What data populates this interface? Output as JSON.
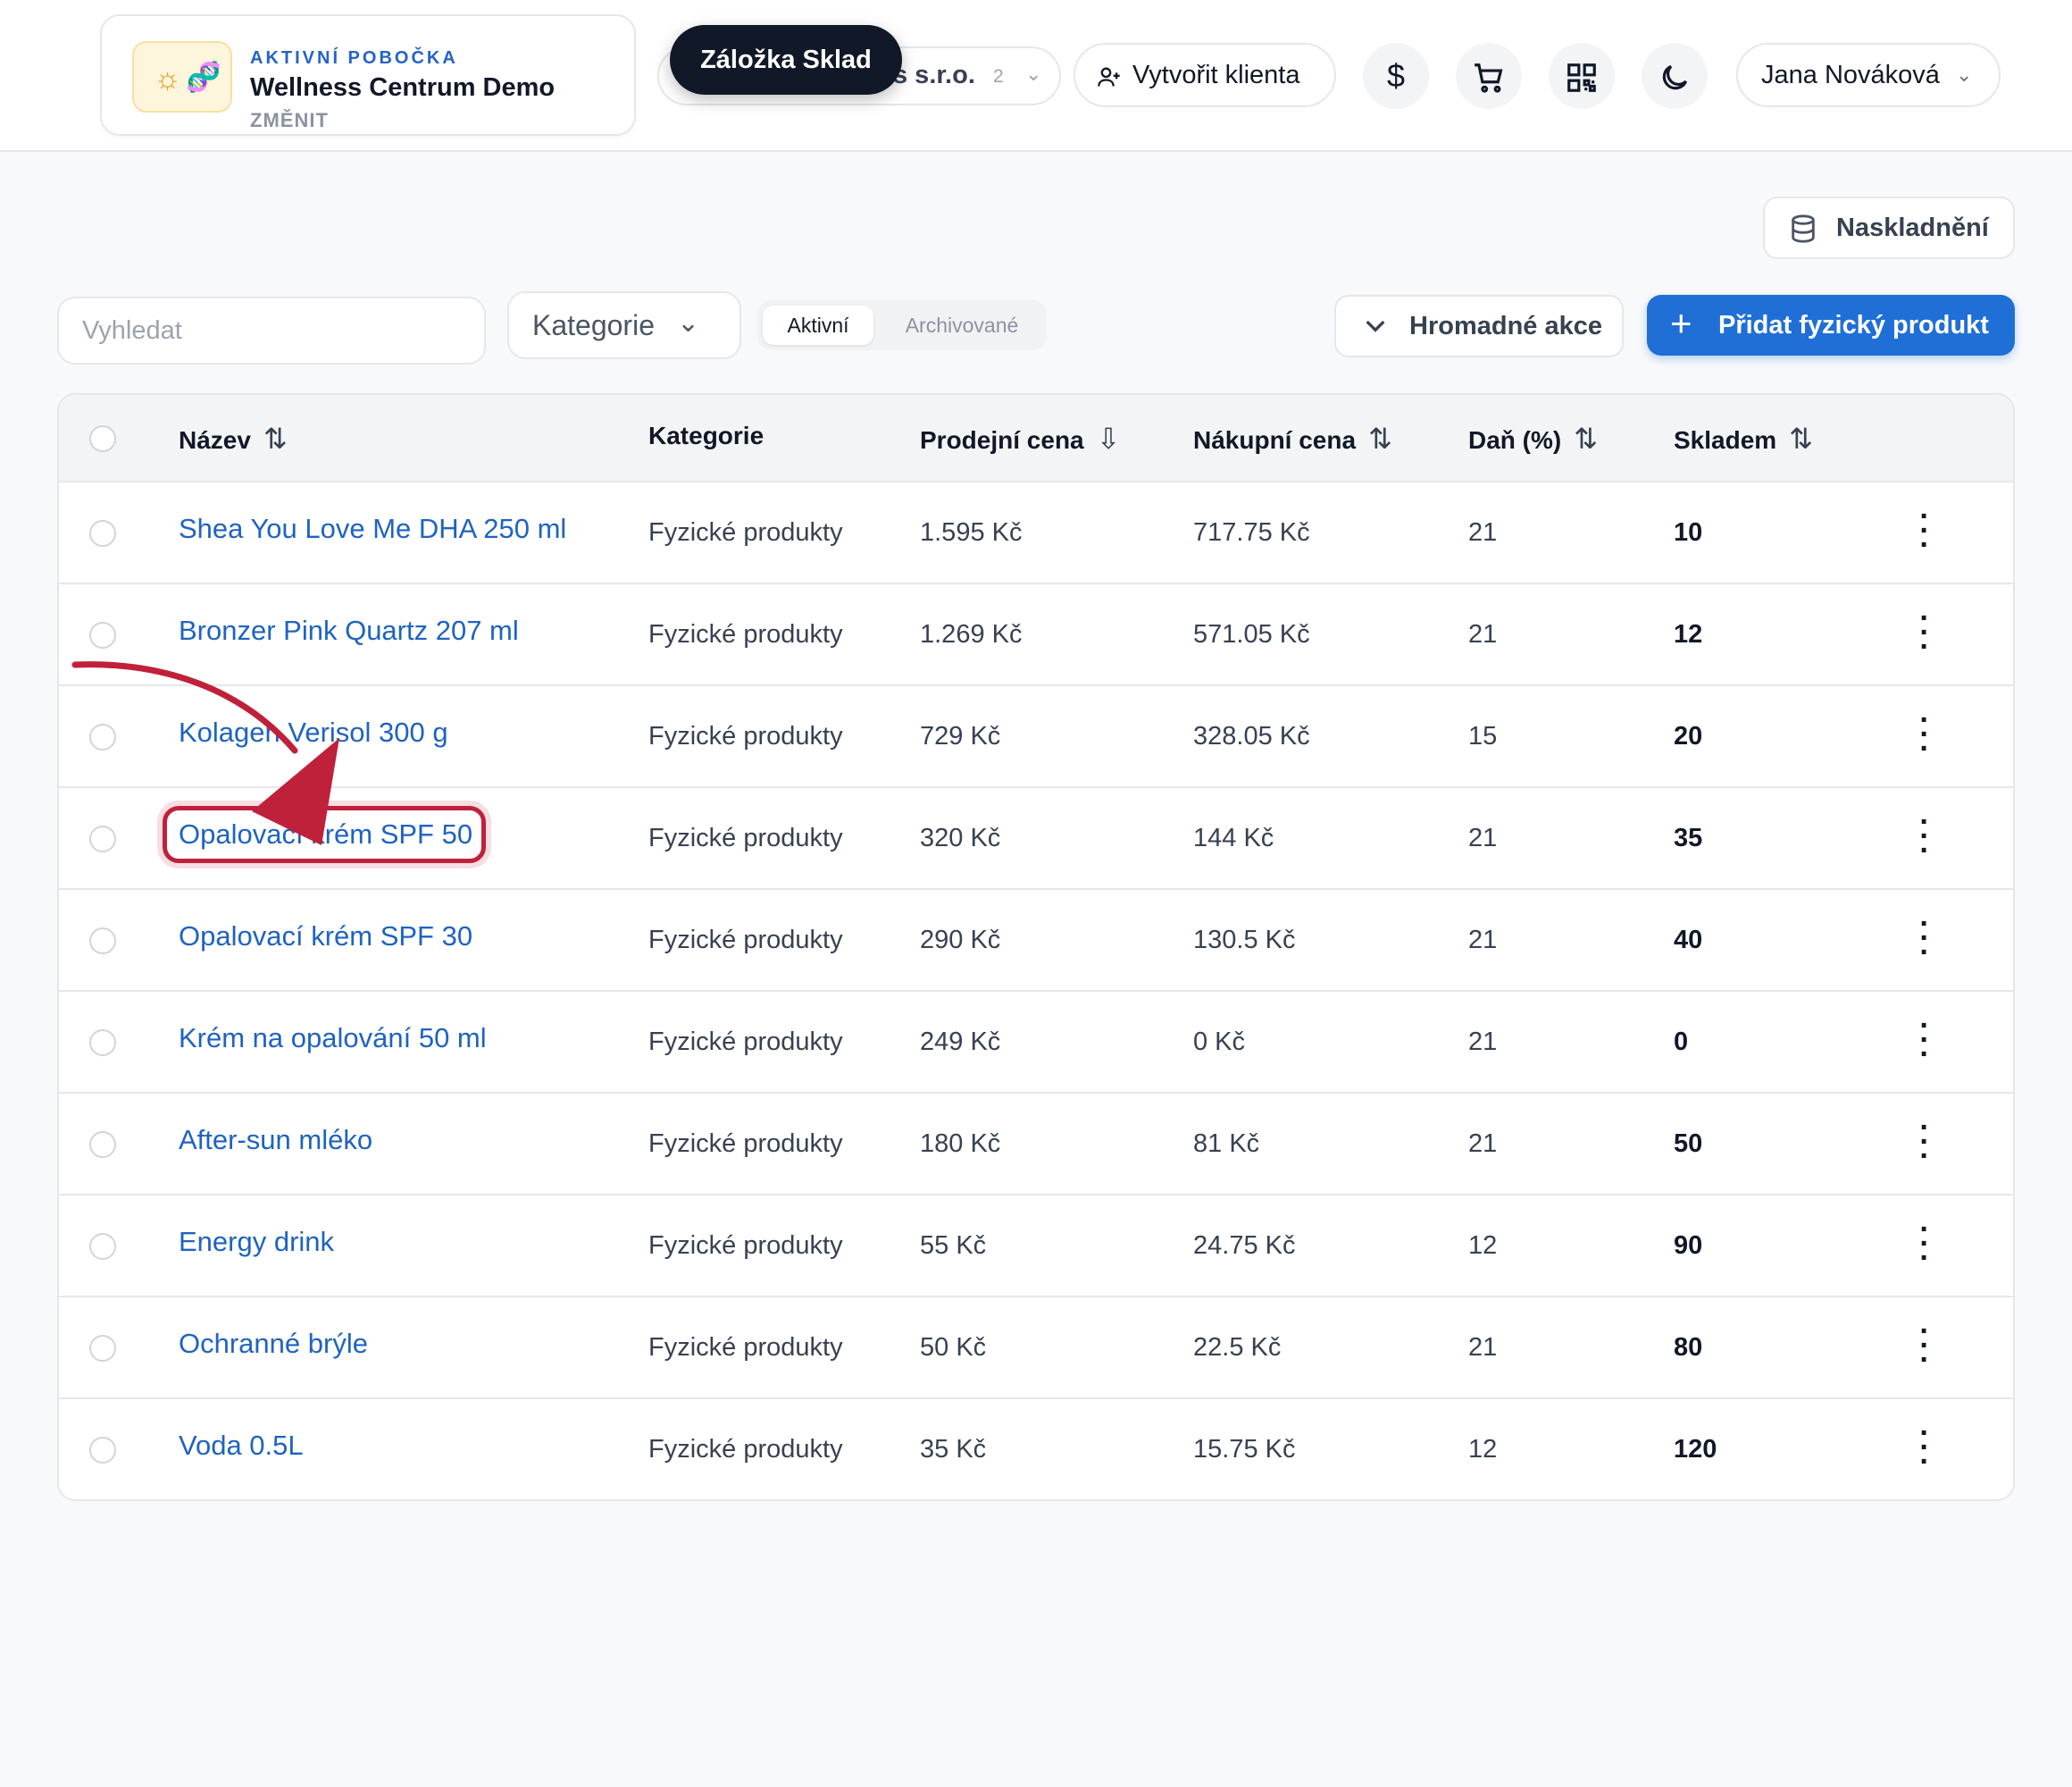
{
  "header": {
    "branch": {
      "eyebrow": "AKTIVNÍ POBOČKA",
      "name": "Wellness Centrum Demo",
      "change_label": "ZMĚNIT",
      "logo_icons": [
        "sun-icon",
        "dna-icon"
      ]
    },
    "company_select": {
      "text": "s s.r.o.",
      "count": "2"
    },
    "tooltip": "Záložka Sklad",
    "create_client_label": "Vytvořit klienta",
    "icon_buttons": [
      "dollar-icon",
      "cart-icon",
      "qr-code-icon",
      "moon-icon"
    ],
    "user_name": "Jana Nováková"
  },
  "toolbar": {
    "stock_in_label": "Naskladnění",
    "search_placeholder": "Vyhledat",
    "category_label": "Kategorie",
    "segment": {
      "active": "Aktivní",
      "archived": "Archivované"
    },
    "bulk_actions_label": "Hromadné akce",
    "add_product_label": "Přidat fyzický produkt"
  },
  "table": {
    "columns": {
      "name": "Název",
      "category": "Kategorie",
      "sell_price": "Prodejní cena",
      "buy_price": "Nákupní cena",
      "tax": "Daň (%)",
      "stock": "Skladem"
    },
    "rows": [
      {
        "name": "Shea You Love Me DHA 250 ml",
        "category": "Fyzické produkty",
        "sell": "1.595 Kč",
        "buy": "717.75 Kč",
        "tax": "21",
        "stock": "10"
      },
      {
        "name": "Bronzer Pink Quartz 207 ml",
        "category": "Fyzické produkty",
        "sell": "1.269 Kč",
        "buy": "571.05 Kč",
        "tax": "21",
        "stock": "12"
      },
      {
        "name": "Kolagen Verisol 300 g",
        "category": "Fyzické produkty",
        "sell": "729 Kč",
        "buy": "328.05 Kč",
        "tax": "15",
        "stock": "20"
      },
      {
        "name": "Opalovací krém SPF 50",
        "category": "Fyzické produkty",
        "sell": "320 Kč",
        "buy": "144 Kč",
        "tax": "21",
        "stock": "35"
      },
      {
        "name": "Opalovací krém SPF 30",
        "category": "Fyzické produkty",
        "sell": "290 Kč",
        "buy": "130.5 Kč",
        "tax": "21",
        "stock": "40"
      },
      {
        "name": "Krém na opalování 50 ml",
        "category": "Fyzické produkty",
        "sell": "249 Kč",
        "buy": "0 Kč",
        "tax": "21",
        "stock": "0"
      },
      {
        "name": "After-sun mléko",
        "category": "Fyzické produkty",
        "sell": "180 Kč",
        "buy": "81 Kč",
        "tax": "21",
        "stock": "50"
      },
      {
        "name": "Energy drink",
        "category": "Fyzické produkty",
        "sell": "55 Kč",
        "buy": "24.75 Kč",
        "tax": "12",
        "stock": "90"
      },
      {
        "name": "Ochranné brýle",
        "category": "Fyzické produkty",
        "sell": "50 Kč",
        "buy": "22.5 Kč",
        "tax": "21",
        "stock": "80"
      },
      {
        "name": "Voda 0.5L",
        "category": "Fyzické produkty",
        "sell": "35 Kč",
        "buy": "15.75 Kč",
        "tax": "12",
        "stock": "120"
      }
    ]
  },
  "annotation": {
    "highlight_color": "#c0213a",
    "highlighted_row": 3
  }
}
